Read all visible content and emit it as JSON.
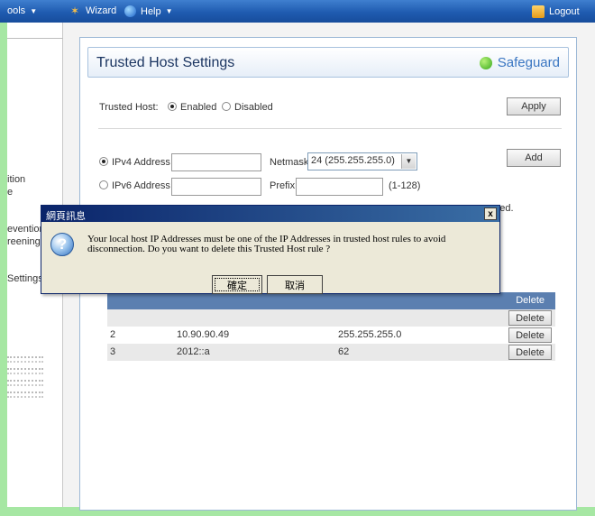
{
  "menubar": {
    "tools_label": "ools",
    "wizard_label": "Wizard",
    "help_label": "Help",
    "logout_label": "Logout"
  },
  "sidebar": {
    "items": [
      "ition",
      "e",
      "evention",
      "reening",
      "Settings"
    ]
  },
  "panel": {
    "title": "Trusted Host Settings",
    "safeguard_label": "Safeguard"
  },
  "trusted_host": {
    "label": "Trusted Host:",
    "enabled_label": "Enabled",
    "disabled_label": "Disabled",
    "selected": "Enabled",
    "apply_label": "Apply"
  },
  "ipv4": {
    "label": "IPv4 Address",
    "value": "",
    "netmask_label": "Netmask",
    "netmask_value": "24 (255.255.255.0)",
    "add_label": "Add"
  },
  "ipv6": {
    "label": "IPv6 Address",
    "value": "",
    "prefix_label": "Prefix",
    "prefix_value": "",
    "prefix_hint": "(1-128)"
  },
  "hidden_text_fragment": "pped.",
  "table": {
    "delete_header": "Delete",
    "rows": [
      {
        "id": "",
        "ip": "",
        "mask": "",
        "action": "Delete"
      },
      {
        "id": "2",
        "ip": "10.90.90.49",
        "mask": "255.255.255.0",
        "action": "Delete"
      },
      {
        "id": "3",
        "ip": "2012::a",
        "mask": "62",
        "action": "Delete"
      }
    ]
  },
  "dialog": {
    "title": "網頁訊息",
    "close_label": "x",
    "message": "Your local host IP Addresses must be one of the IP Addresses in trusted host rules to avoid disconnection. Do you want to delete this Trusted Host rule ?",
    "ok_label": "確定",
    "cancel_label": "取消"
  },
  "colors": {
    "background": "#a6e7a3",
    "menubar": "#1f5bb0",
    "table_header": "#5b7fb0",
    "dialog_title": "#0a246a"
  }
}
